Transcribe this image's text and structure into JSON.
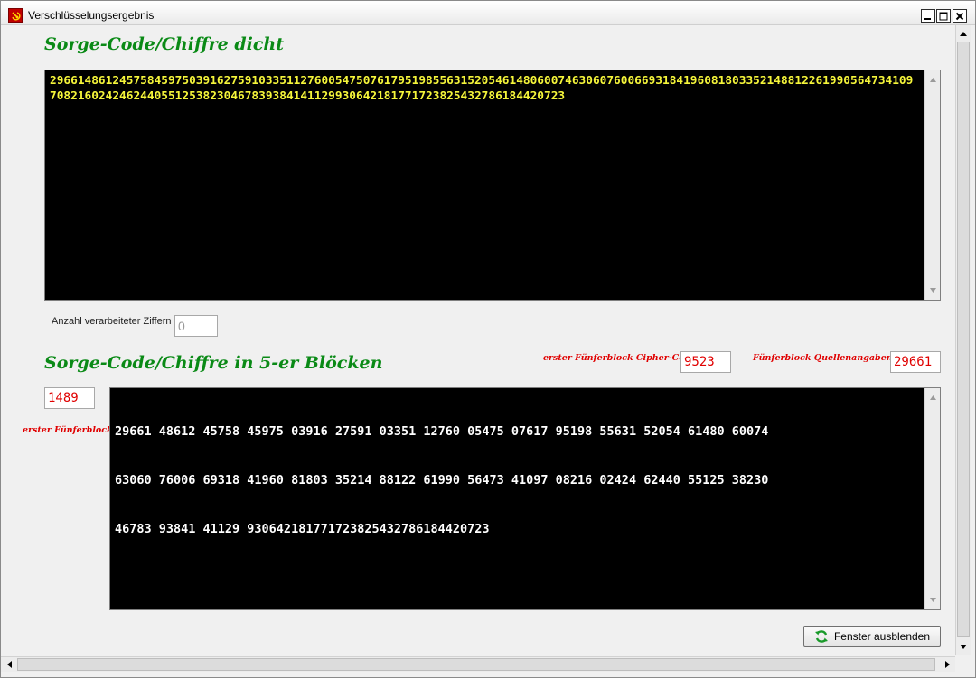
{
  "window": {
    "title": "Verschlüsselungsergebnis"
  },
  "section1": {
    "heading": "Sorge-Code/Chiffre dicht",
    "text": "296614861245758459750391627591033511276005475076179519855631520546148060074630607600669318419608180335214881226199056473410970821602424624405512538230467839384141129930642181771723825432786184420723"
  },
  "counter": {
    "label": "Anzahl verarbeiteter Ziffern",
    "value": "0"
  },
  "section2": {
    "heading": "Sorge-Code/Chiffre in 5-er Blöcken",
    "cipher_label": "erster Fünferblock Cipher-Code",
    "cipher_value": "9523",
    "sources_label": "Fünferblock Quellenangaben",
    "sources_value": "29661",
    "first_block_value": "1489",
    "first_block_label": "erster Fünferblock",
    "lines": [
      "29661 48612 45758 45975 03916 27591 03351 12760 05475 07617 95198 55631 52054 61480 60074",
      "63060 76006 69318 41960 81803 35214 88122 61990 56473 41097 08216 02424 62440 55125 38230",
      "46783 93841 41129 930642181771723825432786184420723"
    ]
  },
  "button": {
    "label": "Fenster ausblenden"
  },
  "icons": {
    "app": "hammer-sickle-icon",
    "refresh": "refresh-icon"
  },
  "colors": {
    "heading": "#0a8a16",
    "red_label": "#e00000",
    "terminal_bg": "#000000",
    "terminal_text_1": "#f5f53a",
    "terminal_text_2": "#ffffff"
  }
}
